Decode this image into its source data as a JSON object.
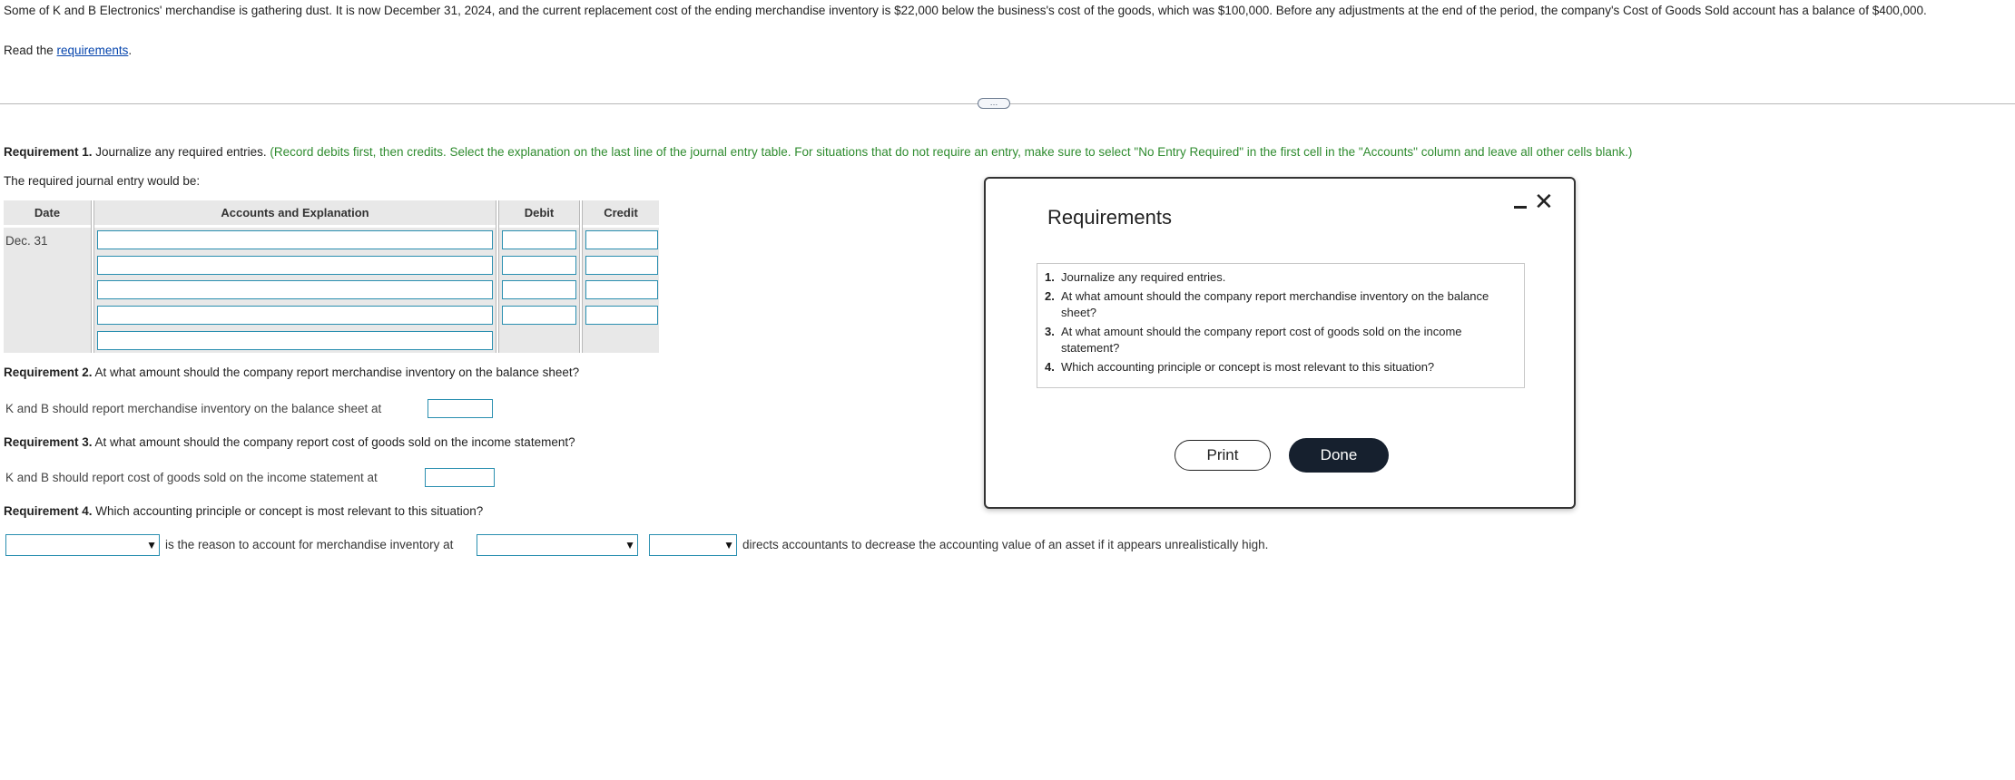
{
  "problem": {
    "text": "Some of K and B Electronics' merchandise is gathering dust. It is now December 31, 2024, and the current replacement cost of the ending merchandise inventory is $22,000 below the business's cost of the goods, which was $100,000. Before any adjustments at the end of the period, the company's Cost of Goods Sold account has a balance of $400,000.",
    "read_prefix": "Read the ",
    "read_link": "requirements",
    "read_suffix": "."
  },
  "expander_label": "…",
  "req1": {
    "head": "Requirement 1.",
    "text": " Journalize any required entries. ",
    "instruction": "(Record debits first, then credits. Select the explanation on the last line of the journal entry table. For situations that do not require an entry, make sure to select \"No Entry Required\" in the first cell in the \"Accounts\" column and leave all other cells blank.)",
    "line2": "The required journal entry would be:"
  },
  "journal": {
    "headers": {
      "date": "Date",
      "accounts": "Accounts and Explanation",
      "debit": "Debit",
      "credit": "Credit"
    },
    "date_value": "Dec. 31"
  },
  "req2": {
    "head": "Requirement 2.",
    "text": " At what amount should the company report merchandise inventory on the balance sheet?",
    "answer_prefix": "K and B should report merchandise inventory on the balance sheet at"
  },
  "req3": {
    "head": "Requirement 3.",
    "text": " At what amount should the company report cost of goods sold on the income statement?",
    "answer_prefix": "K and B should report cost of goods sold on the income statement at"
  },
  "req4": {
    "head": "Requirement 4.",
    "text": " Which accounting principle or concept is most relevant to this situation?",
    "mid_text": "is the reason to account for merchandise inventory at",
    "end_text": "directs accountants to decrease the accounting value of an asset if it appears unrealistically high."
  },
  "modal": {
    "title": "Requirements",
    "items": [
      {
        "num": "1.",
        "text": "Journalize any required entries."
      },
      {
        "num": "2.",
        "text": "At what amount should the company report merchandise inventory on the balance sheet?"
      },
      {
        "num": "3.",
        "text": "At what amount should the company report cost of goods sold on the income statement?"
      },
      {
        "num": "4.",
        "text": "Which accounting principle or concept is most relevant to this situation?"
      }
    ],
    "print_label": "Print",
    "done_label": "Done",
    "close_icon": "close-icon",
    "minimize_icon": "minimize-icon"
  },
  "colors": {
    "instruction_green": "#2e8b2e",
    "input_border": "#2a8fb0",
    "done_bg": "#16202e",
    "table_header_bg": "#e8e8e8"
  }
}
